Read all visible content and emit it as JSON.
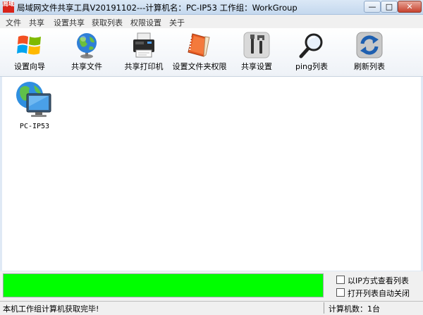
{
  "window": {
    "title": "局域网文件共享工具V20191102---计算机名：PC-IP53  工作组：WorkGroup",
    "app_icon_text": "局域",
    "minimize_glyph": "—",
    "maximize_glyph": "□",
    "close_glyph": "✕"
  },
  "menu": [
    "文件",
    "共享",
    "设置共享",
    "获取列表",
    "权限设置",
    "关于"
  ],
  "toolbar": [
    {
      "label": "设置向导",
      "icon": "windows-logo-icon"
    },
    {
      "label": "共享文件",
      "icon": "globe-icon"
    },
    {
      "label": "共享打印机",
      "icon": "printer-icon"
    },
    {
      "label": "设置文件夹权限",
      "icon": "notebook-icon"
    },
    {
      "label": "共享设置",
      "icon": "tools-icon"
    },
    {
      "label": "ping列表",
      "icon": "magnifier-icon"
    },
    {
      "label": "刷新列表",
      "icon": "refresh-icon"
    }
  ],
  "computers": [
    {
      "name": "PC-IP53",
      "icon": "network-computer-icon"
    }
  ],
  "progress": {
    "value": 1.0,
    "color": "#00ff00"
  },
  "options": [
    {
      "label": "以IP方式查看列表",
      "checked": false
    },
    {
      "label": "打开列表自动关闭",
      "checked": false
    }
  ],
  "status": {
    "left": "本机工作组计算机获取完毕!",
    "right": "计算机数：1台"
  }
}
